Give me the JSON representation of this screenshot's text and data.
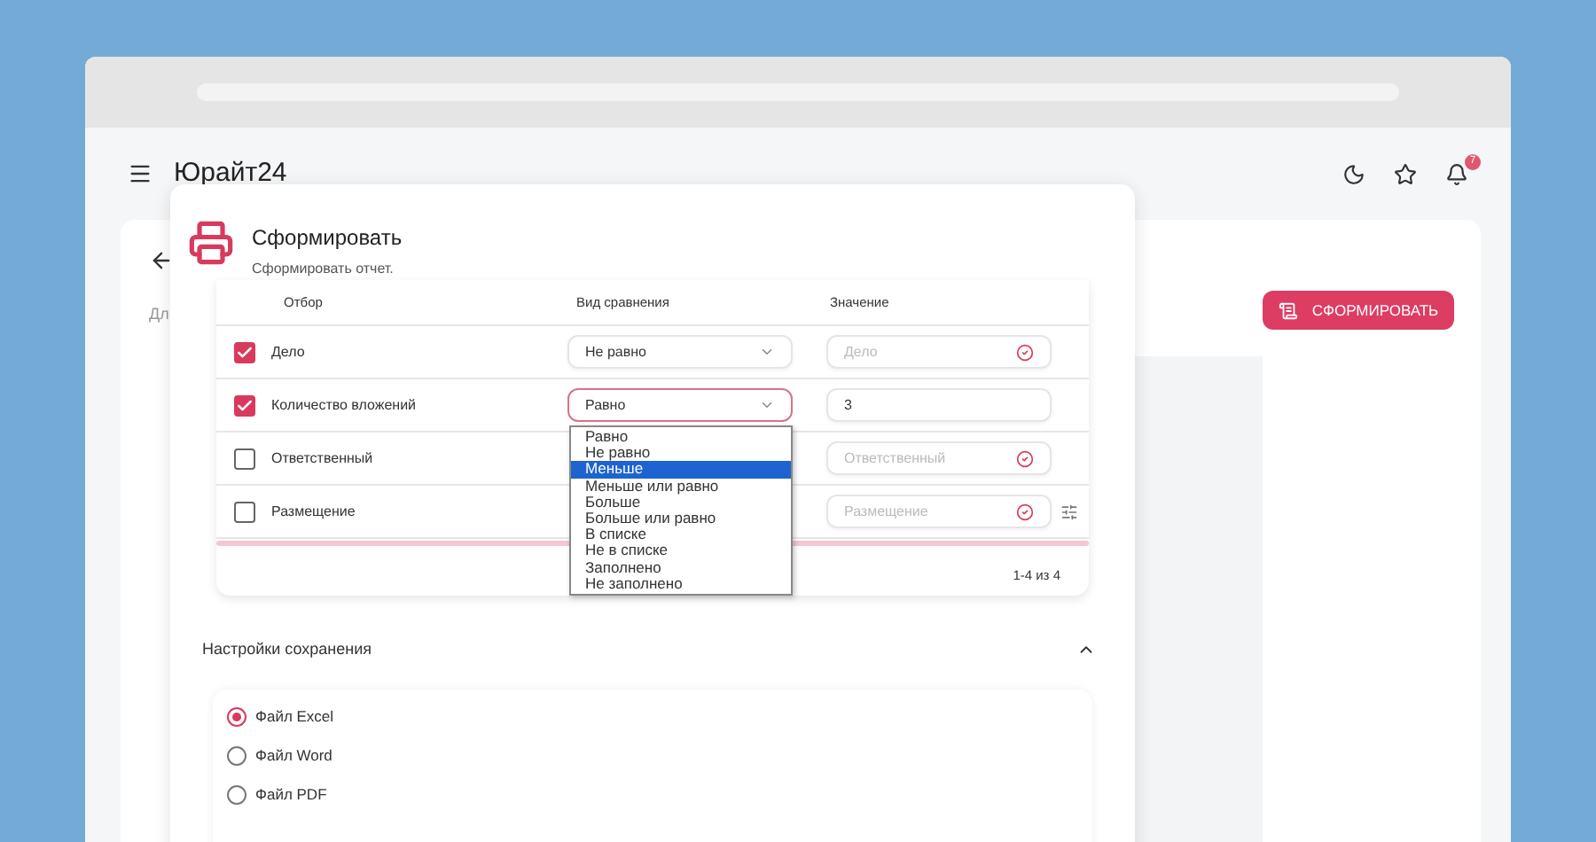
{
  "app_bar": {
    "title": "Юрайт24",
    "notification_count": "7"
  },
  "page": {
    "text": "Дл",
    "action_button": "СФОРМИРОВАТЬ"
  },
  "dialog": {
    "title": "Сформировать",
    "subtitle": "Сформировать отчет.",
    "table": {
      "columns": [
        "Отбор",
        "Вид сравнения",
        "Значение"
      ],
      "rows": [
        {
          "field": "Дело",
          "checked": true,
          "comparison": "Не равно",
          "focused": false,
          "placeholder": "Дело",
          "tune": false
        },
        {
          "field": "Количество вложений",
          "checked": true,
          "comparison": "Равно",
          "focused": true,
          "value": "3",
          "tune": false
        },
        {
          "field": "Ответственный",
          "checked": false,
          "placeholder": "Ответственный",
          "tune": false
        },
        {
          "field": "Размещение",
          "checked": false,
          "placeholder": "Размещение",
          "tune": true
        }
      ],
      "pagination": "1-4 из 4"
    },
    "dropdown": [
      {
        "label": "Равно",
        "selected": false
      },
      {
        "label": "Не равно",
        "selected": false
      },
      {
        "label": "Меньше",
        "selected": true
      },
      {
        "label": "Меньше или равно",
        "selected": false
      },
      {
        "label": "Больше",
        "selected": false
      },
      {
        "label": "Больше или равно",
        "selected": false
      },
      {
        "label": "В списке",
        "selected": false
      },
      {
        "label": "Не в списке",
        "selected": false
      },
      {
        "label": "Заполнено",
        "selected": false
      },
      {
        "label": "Не заполнено",
        "selected": false
      }
    ],
    "save_section": {
      "title": "Настройки сохранения",
      "expanded": true,
      "options": [
        {
          "label": "Файл Excel",
          "selected": true
        },
        {
          "label": "Файл Word",
          "selected": false
        },
        {
          "label": "Файл PDF",
          "selected": false
        }
      ]
    }
  }
}
